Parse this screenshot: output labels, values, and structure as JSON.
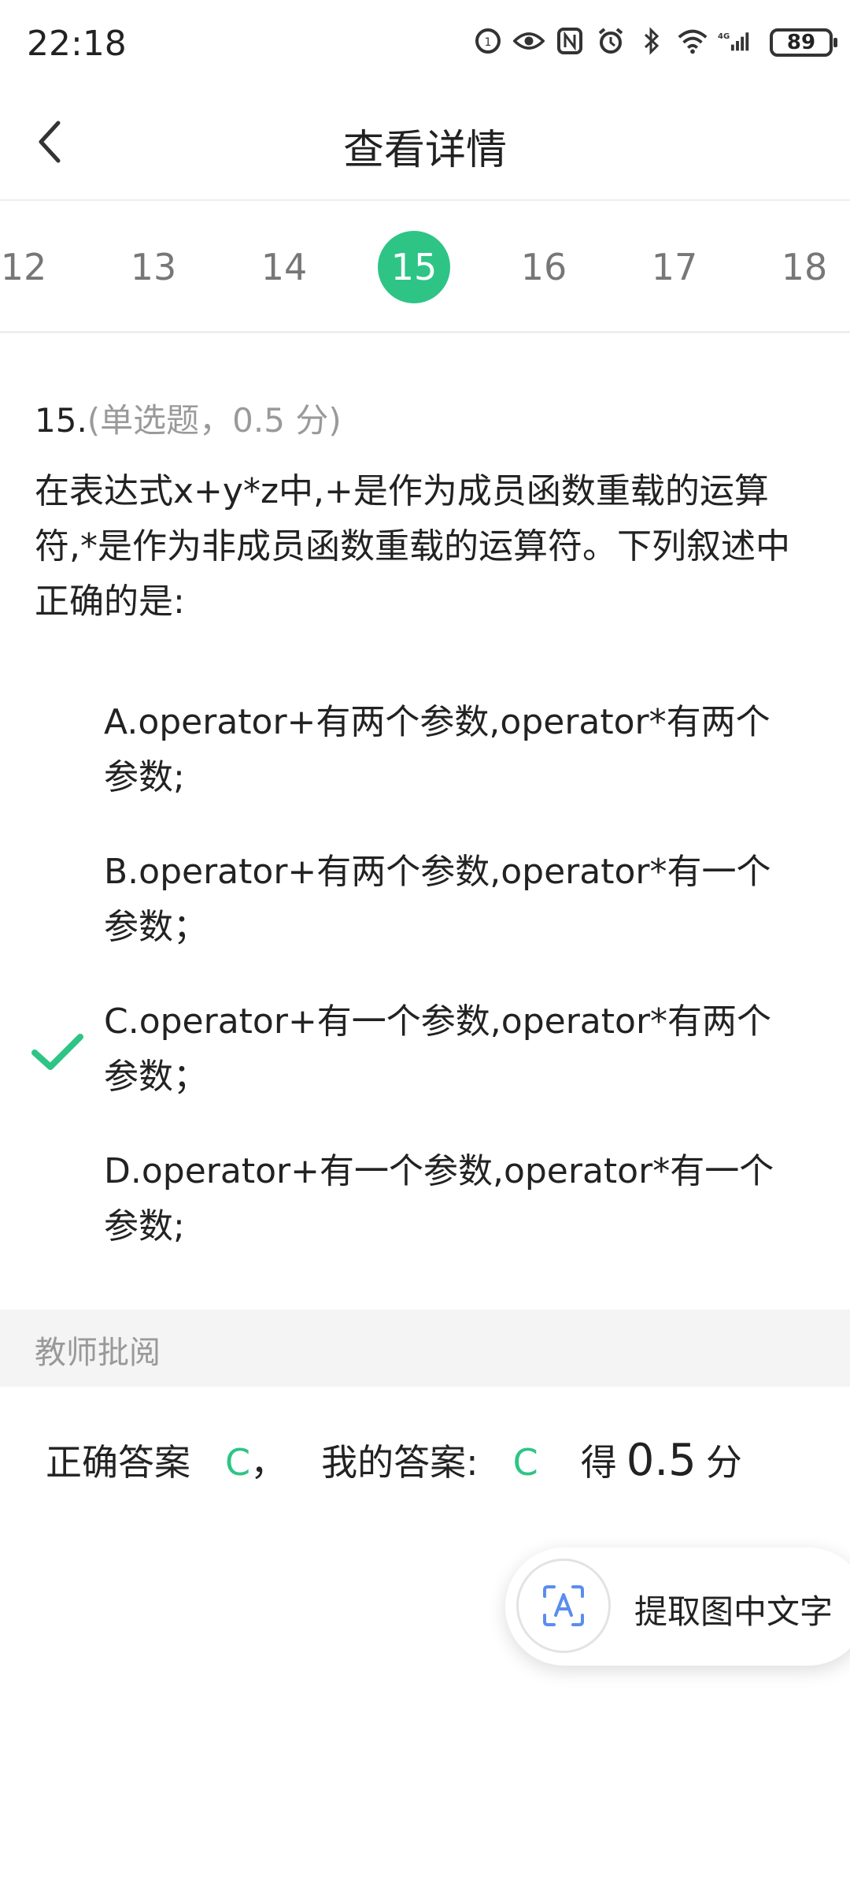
{
  "status": {
    "time": "22:18",
    "battery": "89",
    "icons": [
      "alarm-badge-icon",
      "eye-icon",
      "nfc-icon",
      "alarm-icon",
      "bluetooth-icon",
      "wifi-icon",
      "signal-4g-icon"
    ]
  },
  "nav": {
    "title": "查看详情",
    "back_icon": "chevron-left-icon"
  },
  "numbers": [
    "12",
    "13",
    "14",
    "15",
    "16",
    "17",
    "18"
  ],
  "active_number": "15",
  "question": {
    "number": "15.",
    "type_label": "(单选题，0.5 分)",
    "stem": "在表达式x+y*z中,+是作为成员函数重载的运算符,*是作为非成员函数重载的运算符。下列叙述中正确的是:",
    "options": [
      "A.operator+有两个参数,operator*有两个参数;",
      "B.operator+有两个参数,operator*有一个参数；",
      "C.operator+有一个参数,operator*有两个参数；",
      "D.operator+有一个参数,operator*有一个参数;"
    ],
    "selected_index": 2
  },
  "review": {
    "label": "教师批阅",
    "correct_label": "正确答案",
    "correct_value": "C",
    "sep": "，",
    "mine_label": "我的答案:",
    "mine_value": "C",
    "score_prefix": "得",
    "score": "0.5",
    "score_unit": "分"
  },
  "ocr": {
    "label": "提取图中文字",
    "icon": "text-scan-icon"
  },
  "colors": {
    "accent": "#2ec486"
  }
}
